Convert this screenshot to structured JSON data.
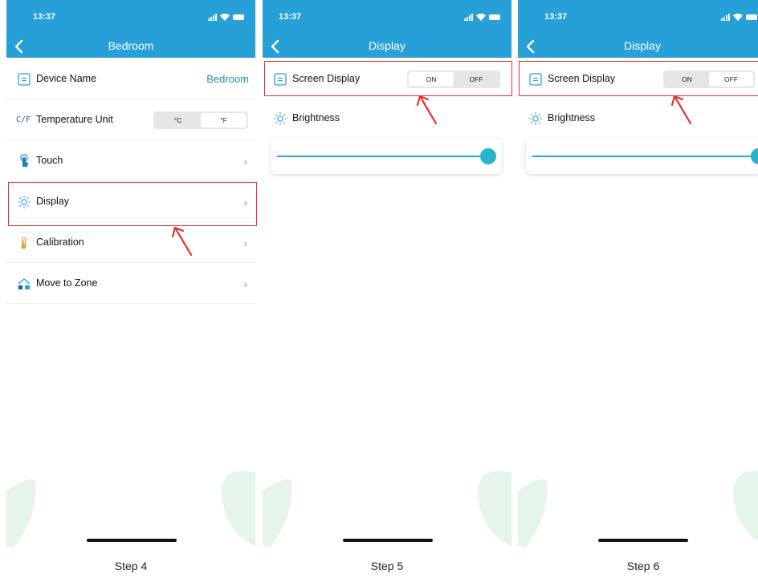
{
  "status_time": "13:37",
  "steps": [
    {
      "nav_title": "Bedroom",
      "device_name_label": "Device Name",
      "device_name_value": "Bedroom",
      "temp_unit_prefix": "C/F",
      "temp_unit_label": "Temperature Unit",
      "temp_options": [
        "°C",
        "°F"
      ],
      "temp_selected": "°F",
      "touch_label": "Touch",
      "display_label": "Display",
      "calibration_label": "Calibration",
      "zone_label": "Move to Zone",
      "chevron": "›",
      "caption": "Step 4"
    },
    {
      "nav_title": "Display",
      "screen_display_label": "Screen Display",
      "screen_options": [
        "ON",
        "OFF"
      ],
      "screen_selected": "ON",
      "brightness_label": "Brightness",
      "brightness_level": 1.0,
      "caption": "Step 5"
    },
    {
      "nav_title": "Display",
      "screen_display_label": "Screen Display",
      "screen_options": [
        "ON",
        "OFF"
      ],
      "screen_selected": "OFF",
      "brightness_label": "Brightness",
      "brightness_level": 1.0,
      "caption": "Step 6"
    }
  ],
  "colors": {
    "header": "#279fd7",
    "accent_teal": "#25b3c8",
    "highlight_red": "#e0312e",
    "leaf_green": "#e6f5ea"
  },
  "icons": [
    "back-chevron-icon",
    "signal-icon",
    "wifi-icon",
    "battery-icon",
    "device-name-icon",
    "temperature-unit-icon",
    "touch-icon",
    "display-sun-icon",
    "thermometer-icon",
    "move-zone-icon",
    "chevron-right-icon",
    "red-arrow-icon"
  ]
}
